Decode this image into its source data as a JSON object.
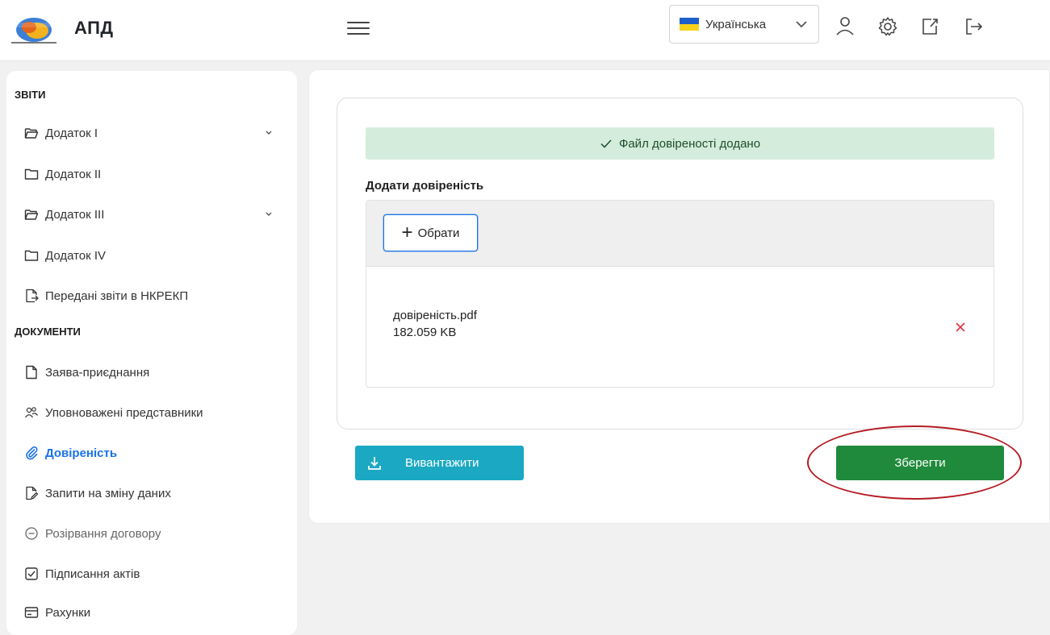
{
  "header": {
    "app_title": "АПД",
    "language": "Українська",
    "icons": [
      "menu-icon",
      "chevron-down-icon",
      "user-icon",
      "gear-icon",
      "external-link-icon",
      "logout-icon"
    ],
    "colors": {
      "flag_blue": "#1f5fc9",
      "flag_yellow": "#f7d21a"
    }
  },
  "sidebar": {
    "section_reports": "ЗВІТИ",
    "section_documents": "ДОКУМЕНТИ",
    "items": [
      {
        "label": "Додаток I",
        "icon": "folder-open-icon",
        "expandable": true
      },
      {
        "label": "Додаток II",
        "icon": "folder-icon",
        "expandable": false
      },
      {
        "label": "Додаток III",
        "icon": "folder-open-icon",
        "expandable": true
      },
      {
        "label": "Додаток IV",
        "icon": "folder-icon",
        "expandable": false
      },
      {
        "label": "Передані звіти в НКРЕКП",
        "icon": "file-export-icon",
        "expandable": false
      },
      {
        "label": "Заява-приєднання",
        "icon": "file-icon",
        "expandable": false
      },
      {
        "label": "Уповноважені представники",
        "icon": "users-icon",
        "expandable": false
      },
      {
        "label": "Довіреність",
        "icon": "paperclip-icon",
        "expandable": false,
        "active": true
      },
      {
        "label": "Запити на зміну даних",
        "icon": "file-edit-icon",
        "expandable": false
      },
      {
        "label": "Розірвання договору",
        "icon": "minus-circle-icon",
        "expandable": false,
        "disabled": true
      },
      {
        "label": "Підписання актів",
        "icon": "checkbox-icon",
        "expandable": false
      },
      {
        "label": "Рахунки",
        "icon": "credit-card-icon",
        "expandable": false
      }
    ],
    "colors": {
      "active": "#1a73e8"
    }
  },
  "main": {
    "success_message": "Файл довіреності додано",
    "field_label": "Додати довіреність",
    "choose_label": "Обрати",
    "file": {
      "name": "довіреність.pdf",
      "size": "182.059 KB"
    },
    "download_label": "Вивантажити",
    "save_label": "Зберегти",
    "colors": {
      "success_bg": "#d4ecdb",
      "download_bg": "#1ba8c3",
      "save_bg": "#1f8a3b",
      "remove": "#dc3545",
      "highlight": "#b51d24"
    }
  }
}
